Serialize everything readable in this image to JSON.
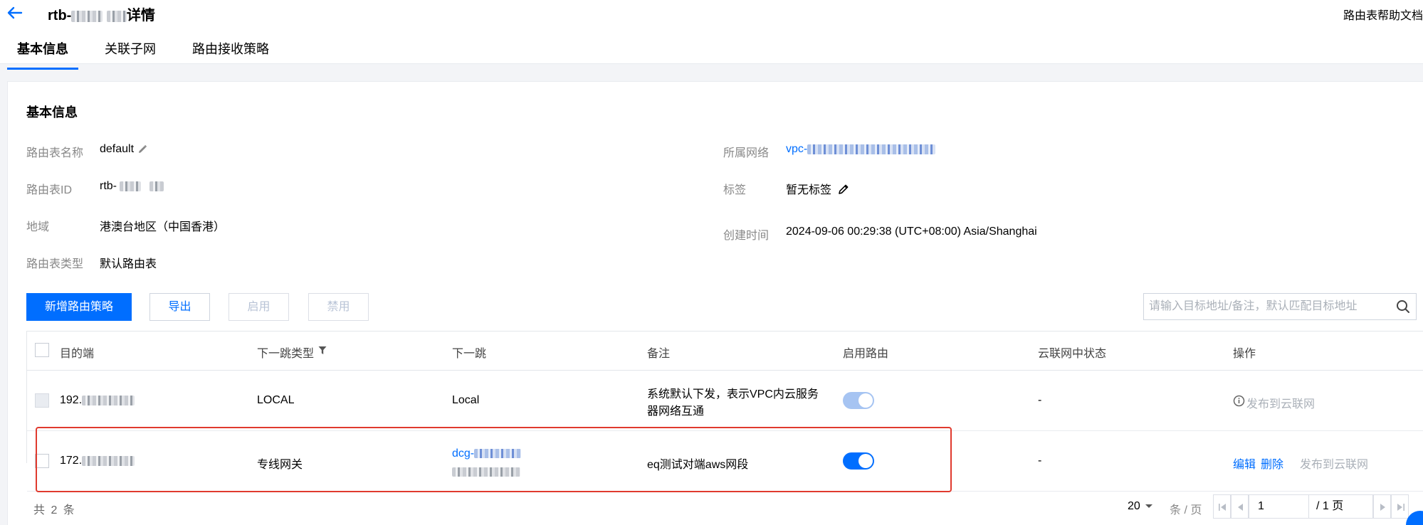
{
  "header": {
    "title_prefix": "rtb-",
    "title_suffix": "详情",
    "help_link": "路由表帮助文档"
  },
  "tabs": [
    {
      "label": "基本信息",
      "active": true
    },
    {
      "label": "关联子网",
      "active": false
    },
    {
      "label": "路由接收策略",
      "active": false
    }
  ],
  "basic_info": {
    "section_title": "基本信息",
    "left": [
      {
        "label": "路由表名称",
        "value": "default"
      },
      {
        "label": "路由表ID",
        "value": "rtb-"
      },
      {
        "label": "地域",
        "value": "港澳台地区（中国香港）"
      },
      {
        "label": "路由表类型",
        "value": "默认路由表"
      }
    ],
    "right": [
      {
        "label": "所属网络",
        "value": "vpc-"
      },
      {
        "label": "标签",
        "value": "暂无标签"
      },
      {
        "label": "创建时间",
        "value": "2024-09-06 00:29:38 (UTC+08:00) Asia/Shanghai"
      }
    ]
  },
  "toolbar": {
    "add_label": "新增路由策略",
    "export_label": "导出",
    "enable_label": "启用",
    "disable_label": "禁用",
    "search_placeholder": "请输入目标地址/备注，默认匹配目标地址"
  },
  "table": {
    "columns": [
      "目的端",
      "下一跳类型",
      "下一跳",
      "备注",
      "启用路由",
      "云联网中状态",
      "操作"
    ],
    "rows": [
      {
        "destination": "192.",
        "next_hop_type": "LOCAL",
        "next_hop": "Local",
        "remark_line1": "系统默认下发，表示VPC内云服务",
        "remark_line2": "器网络互通",
        "enabled": true,
        "ccn_status": "-",
        "ops": [
          "发布到云联网"
        ]
      },
      {
        "destination": "172.",
        "next_hop_type": "专线网关",
        "next_hop": "dcg-",
        "remark": "eq测试对端aws网段",
        "enabled": true,
        "ccn_status": "-",
        "ops": [
          "编辑",
          "删除",
          "发布到云联网"
        ]
      }
    ]
  },
  "footer": {
    "total": "共 2 条",
    "page_size": "20",
    "per_page_label": "条 / 页",
    "current_page": "1",
    "total_pages_label": "/ 1 页"
  },
  "colors": {
    "primary": "#006eff",
    "highlight_border": "#e03a2e"
  }
}
